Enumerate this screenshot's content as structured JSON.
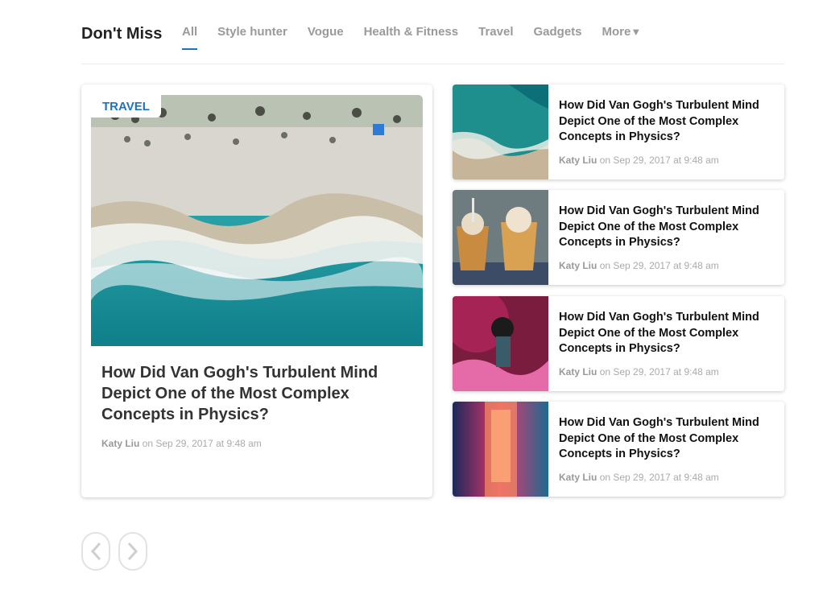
{
  "section": {
    "title": "Don't Miss"
  },
  "tabs": [
    {
      "label": "All",
      "active": true
    },
    {
      "label": "Style hunter"
    },
    {
      "label": "Vogue"
    },
    {
      "label": "Health & Fitness"
    },
    {
      "label": "Travel"
    },
    {
      "label": "Gadgets"
    },
    {
      "label": "More"
    }
  ],
  "featured": {
    "category": "TRAVEL",
    "title": "How Did Van Gogh's Turbulent Mind Depict One of the Most Complex Concepts in Physics?",
    "author": "Katy Liu",
    "date": "on Sep 29, 2017 at 9:48 am"
  },
  "articles": [
    {
      "title": "How Did Van Gogh's Turbulent Mind Depict One of the Most Complex Concepts in Physics?",
      "author": "Katy Liu",
      "date": "on Sep 29, 2017 at 9:48 am"
    },
    {
      "title": "How Did Van Gogh's Turbulent Mind Depict One of the Most Complex Concepts in Physics?",
      "author": "Katy Liu",
      "date": "on Sep 29, 2017 at 9:48 am"
    },
    {
      "title": "How Did Van Gogh's Turbulent Mind Depict One of the Most Complex Concepts in Physics?",
      "author": "Katy Liu",
      "date": "on Sep 29, 2017 at 9:48 am"
    },
    {
      "title": "How Did Van Gogh's Turbulent Mind Depict One of the Most Complex Concepts in Physics?",
      "author": "Katy Liu",
      "date": "on Sep 29, 2017 at 9:48 am"
    }
  ],
  "pager": {
    "prev_icon": "chevron-left-icon",
    "next_icon": "chevron-right-icon"
  },
  "colors": {
    "accent": "#1e73be",
    "meta": "#aaaaaa"
  }
}
